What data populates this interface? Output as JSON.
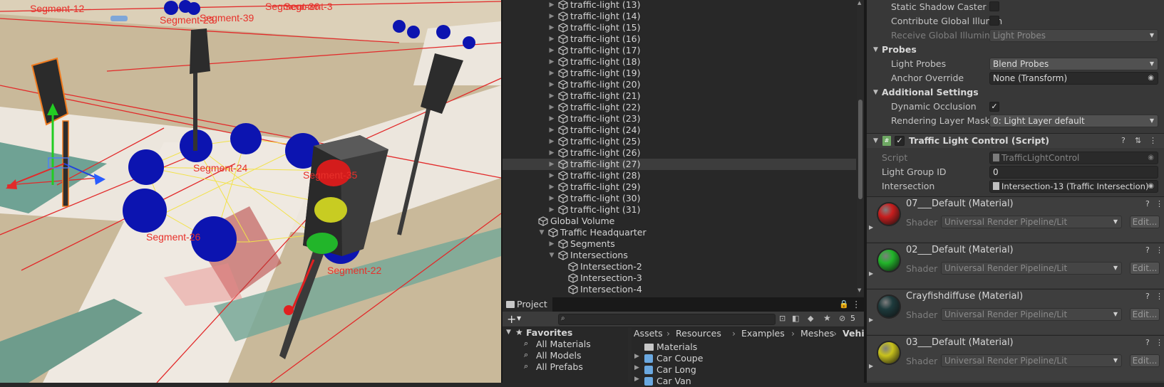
{
  "scene": {
    "labels": [
      "Segment-12",
      "Segment-39",
      "Segment-23",
      "Segment-3",
      "Segment-36",
      "Segment-24",
      "Segment-35",
      "Segment-26",
      "Segment-22"
    ]
  },
  "hierarchy": {
    "items": [
      {
        "label": "traffic-light (13)",
        "kind": "light"
      },
      {
        "label": "traffic-light (14)",
        "kind": "light"
      },
      {
        "label": "traffic-light (15)",
        "kind": "light"
      },
      {
        "label": "traffic-light (16)",
        "kind": "light"
      },
      {
        "label": "traffic-light (17)",
        "kind": "light"
      },
      {
        "label": "traffic-light (18)",
        "kind": "light"
      },
      {
        "label": "traffic-light (19)",
        "kind": "light"
      },
      {
        "label": "traffic-light (20)",
        "kind": "light"
      },
      {
        "label": "traffic-light (21)",
        "kind": "light"
      },
      {
        "label": "traffic-light (22)",
        "kind": "light"
      },
      {
        "label": "traffic-light (23)",
        "kind": "light"
      },
      {
        "label": "traffic-light (24)",
        "kind": "light"
      },
      {
        "label": "traffic-light (25)",
        "kind": "light"
      },
      {
        "label": "traffic-light (26)",
        "kind": "light"
      },
      {
        "label": "traffic-light (27)",
        "kind": "light",
        "selected": true
      },
      {
        "label": "traffic-light (28)",
        "kind": "light"
      },
      {
        "label": "traffic-light (29)",
        "kind": "light"
      },
      {
        "label": "traffic-light (30)",
        "kind": "light"
      },
      {
        "label": "traffic-light (31)",
        "kind": "light"
      },
      {
        "label": "Global Volume",
        "kind": "root"
      },
      {
        "label": "Traffic Headquarter",
        "kind": "parent"
      },
      {
        "label": "Segments",
        "kind": "child-collapsed"
      },
      {
        "label": "Intersections",
        "kind": "child-expanded"
      },
      {
        "label": "Intersection-2",
        "kind": "leaf"
      },
      {
        "label": "Intersection-3",
        "kind": "leaf"
      },
      {
        "label": "Intersection-4",
        "kind": "leaf"
      }
    ]
  },
  "project": {
    "tab_label": "Project",
    "add_icon": "plus-icon",
    "search_placeholder": "",
    "hidden_count": "5",
    "favorites": {
      "header": "Favorites",
      "items": [
        "All Materials",
        "All Models",
        "All Prefabs"
      ]
    },
    "breadcrumb": [
      "Assets",
      "Resources",
      "Examples",
      "Meshes",
      "Vehicles"
    ],
    "assets": [
      "Materials",
      "Car Coupe",
      "Car Long",
      "Car Van"
    ]
  },
  "inspector": {
    "static_shadow_caster": "Static Shadow Caster",
    "contribute_gi": "Contribute Global Illumin",
    "receive_gi": "Receive Global Illuminat",
    "receive_gi_value": "Light Probes",
    "probes_header": "Probes",
    "light_probes_label": "Light Probes",
    "light_probes_value": "Blend Probes",
    "anchor_override_label": "Anchor Override",
    "anchor_override_value": "None (Transform)",
    "additional_header": "Additional Settings",
    "dynamic_occlusion_label": "Dynamic Occlusion",
    "rendering_layer_label": "Rendering Layer Mask",
    "rendering_layer_value": "0: Light Layer default",
    "component_title": "Traffic Light Control (Script)",
    "script_label": "Script",
    "script_value": "TrafficLightControl",
    "group_id_label": "Light Group ID",
    "group_id_value": "0",
    "intersection_label": "Intersection",
    "intersection_value": "Intersection-13 (Traffic Intersection)",
    "shader_label": "Shader",
    "edit_label": "Edit...",
    "materials": [
      {
        "name": "07___Default (Material)",
        "shader": "Universal Render Pipeline/Lit",
        "color": "#c81e1e"
      },
      {
        "name": "02___Default (Material)",
        "shader": "Universal Render Pipeline/Lit",
        "color": "#22b52a"
      },
      {
        "name": "Crayfishdiffuse (Material)",
        "shader": "Universal Render Pipeline/Lit",
        "color": "#1d3a3c"
      },
      {
        "name": "03___Default (Material)",
        "shader": "Universal Render Pipeline/Lit",
        "color": "#c8c21c"
      }
    ]
  }
}
